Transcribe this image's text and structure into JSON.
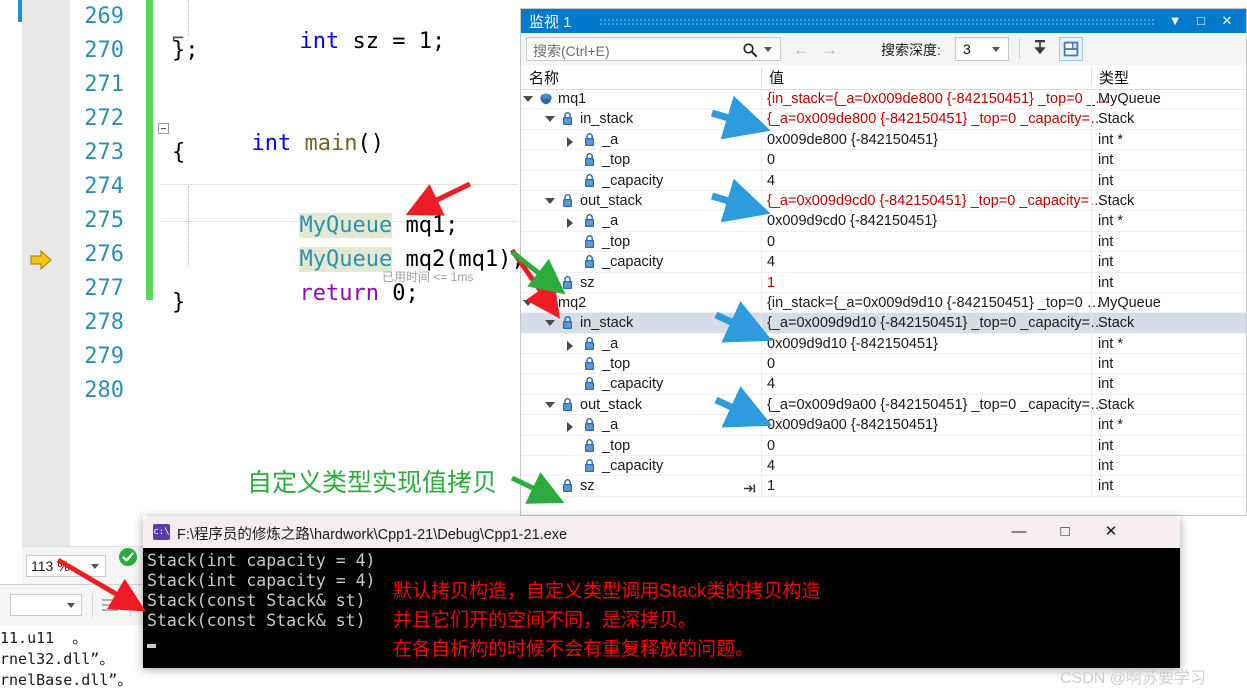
{
  "editor": {
    "lines": [
      {
        "num": "269",
        "text": "    int sz = 1;"
      },
      {
        "num": "270",
        "text": "};"
      },
      {
        "num": "271",
        "text": ""
      },
      {
        "num": "272",
        "text": "int main()"
      },
      {
        "num": "273",
        "text": "{"
      },
      {
        "num": "274",
        "text": "    MyQueue mq1;"
      },
      {
        "num": "275",
        "text": "    MyQueue mq2(mq1);"
      },
      {
        "num": "276",
        "text": "    return 0;"
      },
      {
        "num": "277",
        "text": "}"
      },
      {
        "num": "278",
        "text": ""
      },
      {
        "num": "279",
        "text": ""
      },
      {
        "num": "280",
        "text": ""
      }
    ],
    "tokens": {
      "int": "int",
      "sz_assign": " sz = 1;",
      "brace_close_semi": "};",
      "main": "main",
      "parens": "()",
      "brace_open": "{",
      "myqueue": "MyQueue",
      "mq1_decl": " mq1;",
      "mq2_decl": " mq2(mq1);",
      "return": "return",
      "zero": " 0;",
      "brace_close": "}"
    },
    "elapsed_badge": "已用时间 <= 1ms",
    "zoom_level": "113 %"
  },
  "watch": {
    "title": "监视 1",
    "titlebar_buttons": [
      "▼",
      "□",
      "✕"
    ],
    "search": {
      "placeholder": "搜索(Ctrl+E)"
    },
    "nav": {
      "back": "←",
      "forward": "→"
    },
    "depth_label": "搜索深度:",
    "depth_value": "3",
    "toolbar_icons": [
      "pin-filter-icon",
      "hex-display-icon"
    ],
    "columns": [
      "名称",
      "值",
      "类型"
    ],
    "rows": [
      {
        "indent": 0,
        "twisty": "open",
        "icon": "class-icon",
        "name": "mq1",
        "value": "{in_stack={_a=0x009de800 {-842150451} _top=0 _…",
        "value_red": true,
        "type": "MyQueue",
        "selected": false,
        "pin": false
      },
      {
        "indent": 1,
        "twisty": "open",
        "icon": "field-icon",
        "name": "in_stack",
        "value": "{_a=0x009de800 {-842150451} _top=0 _capacity=…",
        "value_red": true,
        "type": "Stack",
        "selected": false,
        "pin": false
      },
      {
        "indent": 2,
        "twisty": "closed",
        "icon": "field-icon",
        "name": "_a",
        "value": "0x009de800 {-842150451}",
        "value_red": false,
        "type": "int *",
        "selected": false,
        "pin": false
      },
      {
        "indent": 2,
        "twisty": "none",
        "icon": "field-icon",
        "name": "_top",
        "value": "0",
        "value_red": false,
        "type": "int",
        "selected": false,
        "pin": false
      },
      {
        "indent": 2,
        "twisty": "none",
        "icon": "field-icon",
        "name": "_capacity",
        "value": "4",
        "value_red": false,
        "type": "int",
        "selected": false,
        "pin": false
      },
      {
        "indent": 1,
        "twisty": "open",
        "icon": "field-icon",
        "name": "out_stack",
        "value": "{_a=0x009d9cd0 {-842150451} _top=0 _capacity=…",
        "value_red": true,
        "type": "Stack",
        "selected": false,
        "pin": false
      },
      {
        "indent": 2,
        "twisty": "closed",
        "icon": "field-icon",
        "name": "_a",
        "value": "0x009d9cd0 {-842150451}",
        "value_red": false,
        "type": "int *",
        "selected": false,
        "pin": false
      },
      {
        "indent": 2,
        "twisty": "none",
        "icon": "field-icon",
        "name": "_top",
        "value": "0",
        "value_red": false,
        "type": "int",
        "selected": false,
        "pin": false
      },
      {
        "indent": 2,
        "twisty": "none",
        "icon": "field-icon",
        "name": "_capacity",
        "value": "4",
        "value_red": false,
        "type": "int",
        "selected": false,
        "pin": false
      },
      {
        "indent": 1,
        "twisty": "none",
        "icon": "field-icon",
        "name": "sz",
        "value": "1",
        "value_red": true,
        "type": "int",
        "selected": false,
        "pin": false
      },
      {
        "indent": 0,
        "twisty": "open",
        "icon": "class-icon",
        "name": "mq2",
        "value": "{in_stack={_a=0x009d9d10 {-842150451} _top=0 …",
        "value_red": false,
        "type": "MyQueue",
        "selected": false,
        "pin": false
      },
      {
        "indent": 1,
        "twisty": "open",
        "icon": "field-icon",
        "name": "in_stack",
        "value": "{_a=0x009d9d10 {-842150451} _top=0 _capacity=…",
        "value_red": false,
        "type": "Stack",
        "selected": true,
        "pin": false
      },
      {
        "indent": 2,
        "twisty": "closed",
        "icon": "field-icon",
        "name": "_a",
        "value": "0x009d9d10 {-842150451}",
        "value_red": false,
        "type": "int *",
        "selected": false,
        "pin": false
      },
      {
        "indent": 2,
        "twisty": "none",
        "icon": "field-icon",
        "name": "_top",
        "value": "0",
        "value_red": false,
        "type": "int",
        "selected": false,
        "pin": false
      },
      {
        "indent": 2,
        "twisty": "none",
        "icon": "field-icon",
        "name": "_capacity",
        "value": "4",
        "value_red": false,
        "type": "int",
        "selected": false,
        "pin": false
      },
      {
        "indent": 1,
        "twisty": "open",
        "icon": "field-icon",
        "name": "out_stack",
        "value": "{_a=0x009d9a00 {-842150451} _top=0 _capacity=…",
        "value_red": false,
        "type": "Stack",
        "selected": false,
        "pin": false
      },
      {
        "indent": 2,
        "twisty": "closed",
        "icon": "field-icon",
        "name": "_a",
        "value": "0x009d9a00 {-842150451}",
        "value_red": false,
        "type": "int *",
        "selected": false,
        "pin": false
      },
      {
        "indent": 2,
        "twisty": "none",
        "icon": "field-icon",
        "name": "_top",
        "value": "0",
        "value_red": false,
        "type": "int",
        "selected": false,
        "pin": false
      },
      {
        "indent": 2,
        "twisty": "none",
        "icon": "field-icon",
        "name": "_capacity",
        "value": "4",
        "value_red": false,
        "type": "int",
        "selected": false,
        "pin": false
      },
      {
        "indent": 1,
        "twisty": "none",
        "icon": "field-icon",
        "name": "sz",
        "value": "1",
        "value_red": false,
        "type": "int",
        "selected": false,
        "pin": true
      }
    ]
  },
  "console": {
    "path": "F:\\程序员的修炼之路\\hardwork\\Cpp1-21\\Debug\\Cpp1-21.exe",
    "buttons": {
      "minimize": "—",
      "maximize": "□",
      "close": "✕"
    },
    "output": [
      "Stack(int capacity = 4)",
      "Stack(int capacity = 4)",
      "Stack(const Stack& st)",
      "Stack(const Stack& st)"
    ],
    "annotations": [
      "默认拷贝构造，自定义类型调用Stack类的拷贝构造",
      "并且它们开的空间不同，是深拷贝。",
      "在各自析构的时候不会有重复释放的问题。"
    ]
  },
  "output_pane": {
    "lines": [
      "11.u11  。",
      "rnel32.dll”。",
      "rnelBase.dll”。"
    ]
  },
  "annotations": {
    "green_label": "自定义类型实现值拷贝",
    "arrow_colors": {
      "red": "#ee1c24",
      "green": "#2aad3c",
      "blue": "#2e9bdc"
    }
  },
  "watermark": "CSDN @啊苏要学习"
}
